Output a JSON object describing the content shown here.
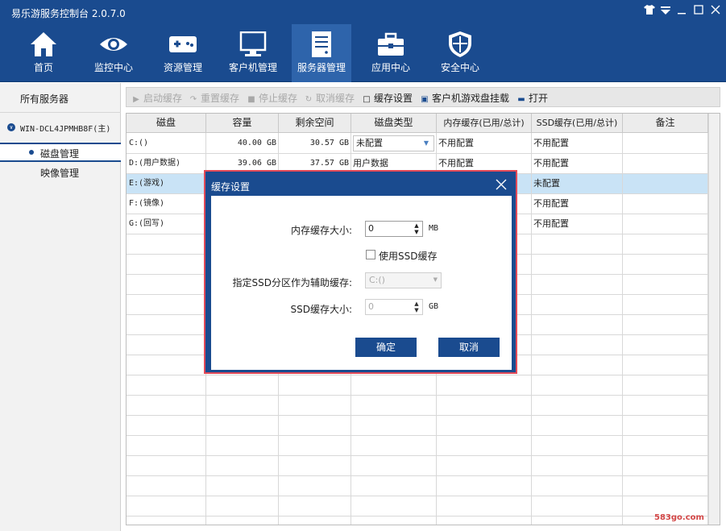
{
  "app": {
    "title": "易乐游服务控制台 2.0.7.0",
    "window_controls": [
      "shirt-icon",
      "dropdown-icon",
      "minimize-icon",
      "maximize-icon",
      "close-icon"
    ]
  },
  "nav": [
    {
      "label": "首页",
      "icon": "home-icon"
    },
    {
      "label": "监控中心",
      "icon": "eye-icon"
    },
    {
      "label": "资源管理",
      "icon": "gamepad-icon"
    },
    {
      "label": "客户机管理",
      "icon": "monitor-icon"
    },
    {
      "label": "服务器管理",
      "icon": "server-icon",
      "active": true
    },
    {
      "label": "应用中心",
      "icon": "toolbox-icon"
    },
    {
      "label": "安全中心",
      "icon": "shield-icon"
    }
  ],
  "sidebar": {
    "header": "所有服务器",
    "server": "WIN-DCL4JPMHB8F(主)",
    "items": [
      "磁盘管理",
      "映像管理"
    ]
  },
  "toolbar": [
    {
      "label": "启动缓存",
      "icon": "play-icon",
      "disabled": true
    },
    {
      "label": "重置缓存",
      "icon": "reset-icon",
      "disabled": true
    },
    {
      "label": "停止缓存",
      "icon": "stop-icon",
      "disabled": true
    },
    {
      "label": "取消缓存",
      "icon": "refresh-icon",
      "disabled": true
    },
    {
      "label": "缓存设置",
      "icon": "square-icon",
      "disabled": false
    },
    {
      "label": "客户机游戏盘挂载",
      "icon": "disk-icon",
      "disabled": false
    },
    {
      "label": "打开",
      "icon": "folder-icon",
      "disabled": false
    }
  ],
  "table": {
    "columns": [
      "磁盘",
      "容量",
      "剩余空间",
      "磁盘类型",
      "内存缓存(已用/总计)",
      "SSD缓存(已用/总计)",
      "备注"
    ],
    "rows": [
      {
        "disk": "C:()",
        "capacity": "40.00 GB",
        "free": "30.57 GB",
        "type": "未配置",
        "mem": "不用配置",
        "ssd": "不用配置",
        "note": ""
      },
      {
        "disk": "D:(用户数据)",
        "capacity": "39.06 GB",
        "free": "37.57 GB",
        "type": "用户数据",
        "mem": "不用配置",
        "ssd": "不用配置",
        "note": ""
      },
      {
        "disk": "E:(游戏)",
        "capacity": "",
        "free": "",
        "type": "",
        "mem": "",
        "ssd": "未配置",
        "note": ""
      },
      {
        "disk": "F:(镜像)",
        "capacity": "",
        "free": "",
        "type": "",
        "mem": "",
        "ssd": "不用配置",
        "note": ""
      },
      {
        "disk": "G:(回写)",
        "capacity": "",
        "free": "",
        "type": "",
        "mem": "",
        "ssd": "不用配置",
        "note": ""
      }
    ],
    "selected_row_index": 2
  },
  "dialog": {
    "title": "缓存设置",
    "mem_cache_label": "内存缓存大小:",
    "mem_cache_value": "0",
    "mem_cache_unit": "MB",
    "use_ssd_label": "使用SSD缓存",
    "use_ssd_checked": false,
    "ssd_partition_label": "指定SSD分区作为辅助缓存:",
    "ssd_partition_value": "C:()",
    "ssd_size_label": "SSD缓存大小:",
    "ssd_size_value": "0",
    "ssd_size_unit": "GB",
    "ok_label": "确定",
    "cancel_label": "取消"
  },
  "watermark": "583go.com"
}
